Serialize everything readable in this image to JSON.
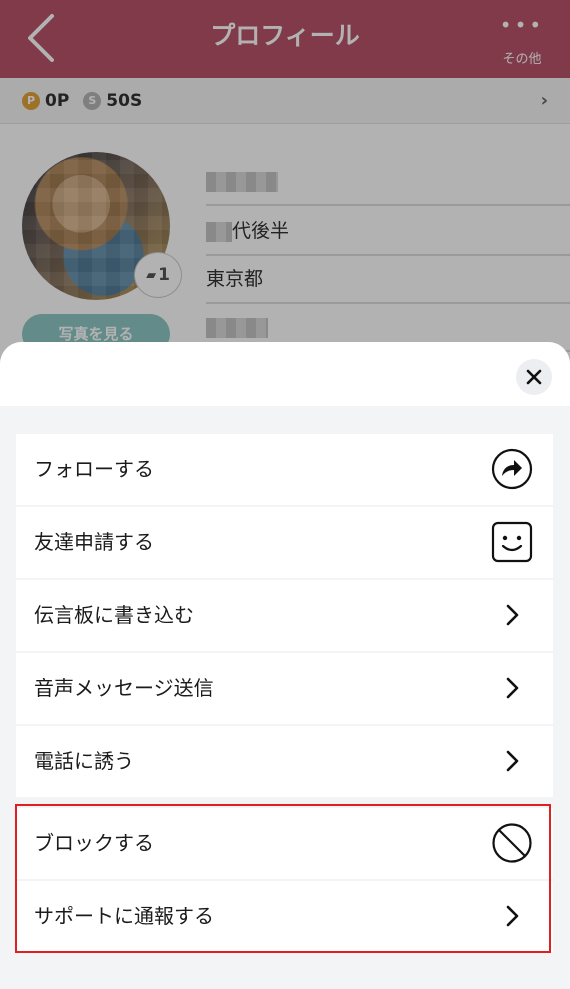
{
  "header": {
    "title": "プロフィール",
    "more_label": "その他"
  },
  "points": {
    "p_value": "0P",
    "s_value": "50S"
  },
  "profile": {
    "photo_count": "1",
    "photo_button_label": "写真を見る",
    "age": "代後半",
    "region": "東京都"
  },
  "menu": {
    "items": [
      {
        "label": "フォローする",
        "icon": "follow-arrow-icon"
      },
      {
        "label": "友達申請する",
        "icon": "smile-face-icon"
      },
      {
        "label": "伝言板に書き込む",
        "icon": "chevron-right-icon"
      },
      {
        "label": "音声メッセージ送信",
        "icon": "chevron-right-icon"
      },
      {
        "label": "電話に誘う",
        "icon": "chevron-right-icon"
      },
      {
        "label": "ブロックする",
        "icon": "block-icon"
      },
      {
        "label": "サポートに通報する",
        "icon": "chevron-right-icon"
      }
    ]
  },
  "colors": {
    "header": "#b8546a",
    "highlight": "#e02020",
    "accent": "#8dc7c5"
  }
}
